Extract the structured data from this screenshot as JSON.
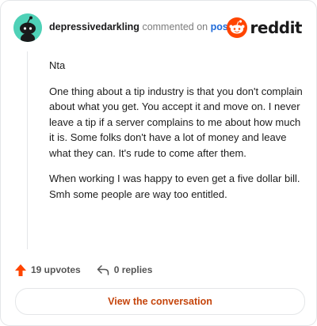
{
  "header": {
    "username": "depressivedarkling",
    "action_text": "commented on",
    "post_link": "post",
    "brand": "reddit"
  },
  "comment": {
    "paragraphs": [
      "Nta",
      "One thing about a tip industry is that you don't complain about what you get. You accept it and move on. I never leave a tip if a server complains to me about how much it is. Some folks don't have a lot of money and leave what they can. It's rude to come after them.",
      "When working I was happy to even get a five dollar bill. Smh some people are way too entitled."
    ]
  },
  "actions": {
    "upvotes": "19 upvotes",
    "replies": "0 replies"
  },
  "cta": {
    "label": "View the conversation"
  },
  "colors": {
    "brand_orange": "#ff4500",
    "avatar_bg": "#4fd1b7",
    "link_blue": "#1e6ad8",
    "cta_text": "#c5450c"
  }
}
